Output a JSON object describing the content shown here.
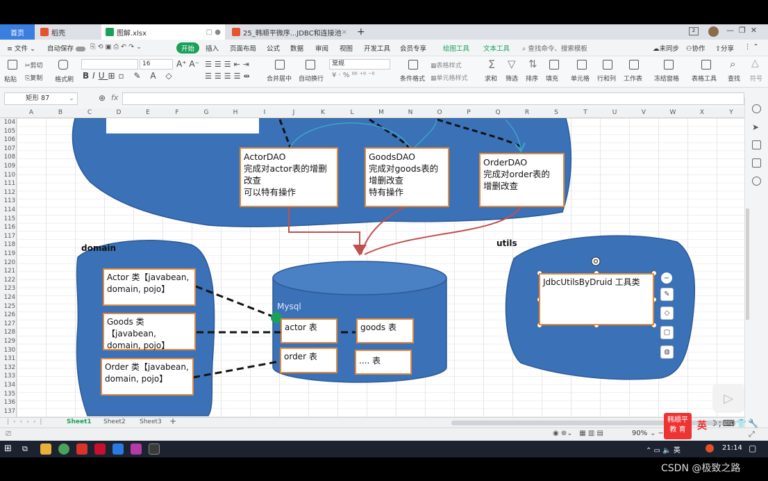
{
  "tabs": {
    "home": "首页",
    "daoke": "稻壳",
    "file": "图解.xlsx",
    "pdf": "25_韩顺平微序...JDBC和连接池",
    "add": "+"
  },
  "menu": {
    "file": "文件",
    "autosave": "自动保存",
    "start": "开始",
    "insert": "插入",
    "layout": "页面布局",
    "formula": "公式",
    "data": "数据",
    "review": "审阅",
    "view": "视图",
    "dev": "开发工具",
    "member": "会员专享",
    "draw": "绘图工具",
    "text": "文本工具",
    "search": "查找命令、搜索模板",
    "sync": "未同步",
    "collab": "协作",
    "share": "分享"
  },
  "toolbar": {
    "paste": "粘贴",
    "cut": "剪切",
    "copy": "复制",
    "format_painter": "格式刷",
    "font_size": "16",
    "number_format": "常规",
    "merge": "合并居中",
    "wrap": "自动换行",
    "cond_format": "条件格式",
    "table_style": "表格样式",
    "cell_style": "单元格样式",
    "sum": "求和",
    "filter": "筛选",
    "sort": "排序",
    "fill": "填充",
    "cells": "单元格",
    "rowcol": "行和列",
    "worksheet": "工作表",
    "freeze": "冻结窗格",
    "table_tools": "表格工具",
    "find": "查找",
    "symbol": "符号"
  },
  "formula_bar": {
    "name_box": "矩形 87",
    "fx": "fx"
  },
  "columns": [
    "A",
    "B",
    "C",
    "D",
    "E",
    "F",
    "G",
    "H",
    "I",
    "J",
    "K",
    "L",
    "M",
    "N",
    "O",
    "P",
    "Q",
    "R",
    "S",
    "T",
    "U",
    "V",
    "W",
    "X",
    "Y"
  ],
  "rows": [
    "104",
    "105",
    "106",
    "107",
    "108",
    "109",
    "110",
    "111",
    "112",
    "113",
    "114",
    "115",
    "116",
    "117",
    "118",
    "119",
    "120",
    "121",
    "122",
    "123",
    "124",
    "125",
    "126",
    "127",
    "128",
    "129",
    "130",
    "131",
    "132",
    "133",
    "134",
    "135",
    "136",
    "137"
  ],
  "diagram": {
    "dao_boxes": [
      {
        "title": "ActorDAO",
        "lines": [
          "完成对actor表的增删",
          "改查",
          "可以特有操作"
        ]
      },
      {
        "title": "GoodsDAO",
        "lines": [
          "完成对goods表的",
          "增删改查",
          "特有操作"
        ]
      },
      {
        "title": "OrderDAO",
        "lines": [
          "完成对order表的",
          "增删改查"
        ]
      }
    ],
    "domain_label": "domain",
    "domain_boxes": [
      "Actor 类【javabean, domain, pojo】",
      "Goods 类【javabean, domain, pojo】",
      "Order 类【javabean, domain, pojo】"
    ],
    "db_label": "Mysql",
    "tables": [
      "actor 表",
      "goods 表",
      "order 表",
      ".... 表"
    ],
    "utils_label": "utils",
    "utils_box": "JdbcUtilsByDruid 工具类",
    "colors": {
      "blob": "#3b71b7",
      "blob_edge": "#2c5a96",
      "box_border": "#e38a3a",
      "arrow": "#c0504d",
      "connector_teal": "#3aa5c9"
    }
  },
  "sheets": {
    "s1": "Sheet1",
    "s2": "Sheet2",
    "s3": "Sheet3",
    "add": "+"
  },
  "status": {
    "zoom": "90%",
    "input_method": "英",
    "logo_line1": "韩顺平",
    "logo_line2": "教 育"
  },
  "taskbar": {
    "time": "21:14",
    "lang": "英"
  },
  "watermark": "CSDN @极致之路"
}
